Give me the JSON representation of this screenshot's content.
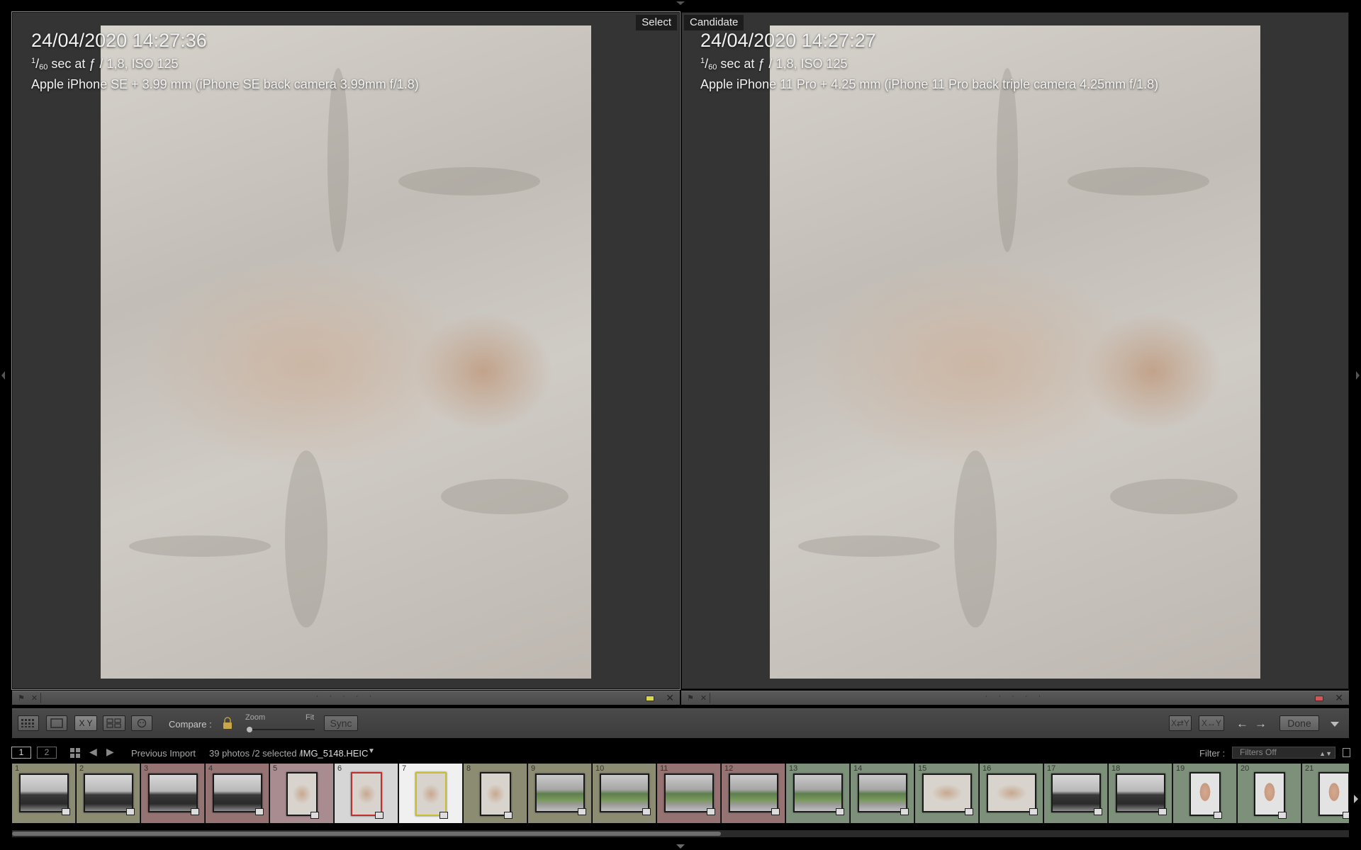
{
  "left_pane": {
    "label": "Select",
    "date": "24/04/2020 14:27:36",
    "exposure": {
      "num": "1",
      "den": "60",
      "text": " sec at ƒ / 1,8, ISO 125"
    },
    "camera": "Apple iPhone SE + 3.99 mm (iPhone SE back camera 3.99mm f/1.8)",
    "color_label": "#d8d84a"
  },
  "right_pane": {
    "label": "Candidate",
    "date": "24/04/2020 14:27:27",
    "exposure": {
      "num": "1",
      "den": "60",
      "text": " sec at ƒ / 1,8, ISO 125"
    },
    "camera": "Apple iPhone 11 Pro + 4.25 mm (iPhone 11 Pro back triple camera 4.25mm f/1.8)",
    "color_label": "#d85454"
  },
  "pane_bar": {
    "flags": "⚑ ✕",
    "dots": "· · · · ·",
    "close": "✕"
  },
  "toolbar": {
    "compare_label": "Compare :",
    "zoom_label": "Zoom",
    "fit_label": "Fit",
    "zoom_value": 0,
    "sync_label": "Sync",
    "done_label": "Done",
    "xy_label": "X Y",
    "xy_swap_label": "X⇄Y",
    "xy_make_label": "X↔Y",
    "prev_arrow": "←",
    "next_arrow": "→"
  },
  "navbar": {
    "page1": "1",
    "page2": "2",
    "source": "Previous Import",
    "count": "39 photos /2 selected /",
    "filename": "IMG_5148.HEIC",
    "filter_label": "Filter :",
    "filter_value": "Filters Off",
    "prev_arrow": "◀",
    "next_arrow": "▶"
  },
  "filmstrip": {
    "cells": [
      {
        "num": "1",
        "bg": "#8c8c73",
        "kind": "kitchen"
      },
      {
        "num": "2",
        "bg": "#8c8c73",
        "kind": "kitchen"
      },
      {
        "num": "3",
        "bg": "#957373",
        "kind": "kitchen"
      },
      {
        "num": "4",
        "bg": "#957373",
        "kind": "kitchen"
      },
      {
        "num": "5",
        "bg": "#a88c90",
        "kind": "cat-portrait"
      },
      {
        "num": "6",
        "bg": "#d6d6d6",
        "kind": "cat-portrait",
        "selected": "red"
      },
      {
        "num": "7",
        "bg": "#f0f0f0",
        "kind": "cat-portrait",
        "selected": "yellow"
      },
      {
        "num": "8",
        "bg": "#8c8c73",
        "kind": "cat-portrait"
      },
      {
        "num": "9",
        "bg": "#8c8c73",
        "kind": "road"
      },
      {
        "num": "10",
        "bg": "#8c8c73",
        "kind": "road"
      },
      {
        "num": "11",
        "bg": "#957373",
        "kind": "road"
      },
      {
        "num": "12",
        "bg": "#957373",
        "kind": "road"
      },
      {
        "num": "13",
        "bg": "#7d917a",
        "kind": "road"
      },
      {
        "num": "14",
        "bg": "#7d917a",
        "kind": "road"
      },
      {
        "num": "15",
        "bg": "#7d917a",
        "kind": "cat"
      },
      {
        "num": "16",
        "bg": "#7d917a",
        "kind": "cat"
      },
      {
        "num": "17",
        "bg": "#7d917a",
        "kind": "kitchen"
      },
      {
        "num": "18",
        "bg": "#7d917a",
        "kind": "kitchen"
      },
      {
        "num": "19",
        "bg": "#7d917a",
        "kind": "face"
      },
      {
        "num": "20",
        "bg": "#7d917a",
        "kind": "face"
      },
      {
        "num": "21",
        "bg": "#7d917a",
        "kind": "face"
      }
    ]
  }
}
